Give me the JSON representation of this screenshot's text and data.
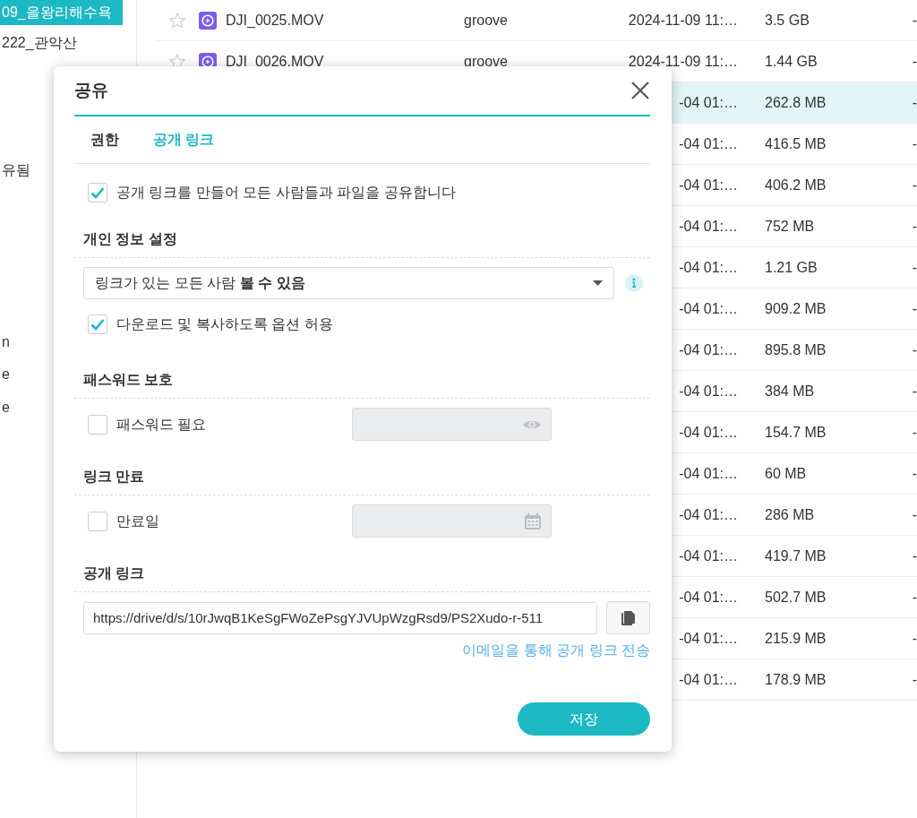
{
  "sidebar": {
    "items": [
      {
        "label": "09_을왕리해수욕",
        "selected": true
      },
      {
        "label": "222_관악산",
        "selected": false
      },
      {
        "label": "유됨",
        "selected": false
      },
      {
        "label": "n",
        "selected": false
      },
      {
        "label": "e",
        "selected": false
      },
      {
        "label": "e",
        "selected": false
      }
    ]
  },
  "file_list": {
    "rows": [
      {
        "starred": false,
        "name": "DJI_0025.MOV",
        "owner": "groove",
        "modified": "2024-11-09 11:…",
        "size": "3.5 GB",
        "column_5": "-",
        "selected": false
      },
      {
        "starred": false,
        "name": "DJI_0026.MOV",
        "owner": "groove",
        "modified": "2024-11-09 11:…",
        "size": "1.44 GB",
        "column_5": "-",
        "selected": false
      },
      {
        "modified": "-04 01:…",
        "size": "262.8 MB",
        "column_5": "-",
        "selected": true
      },
      {
        "modified": "-04 01:…",
        "size": "416.5 MB",
        "column_5": "-",
        "selected": false
      },
      {
        "modified": "-04 01:…",
        "size": "406.2 MB",
        "column_5": "-",
        "selected": false
      },
      {
        "modified": "-04 01:…",
        "size": "752 MB",
        "column_5": "-",
        "selected": false
      },
      {
        "modified": "-04 01:…",
        "size": "1.21 GB",
        "column_5": "-",
        "selected": false
      },
      {
        "modified": "-04 01:…",
        "size": "909.2 MB",
        "column_5": "-",
        "selected": false
      },
      {
        "modified": "-04 01:…",
        "size": "895.8 MB",
        "column_5": "-",
        "selected": false
      },
      {
        "modified": "-04 01:…",
        "size": "384 MB",
        "column_5": "-",
        "selected": false
      },
      {
        "modified": "-04 01:…",
        "size": "154.7 MB",
        "column_5": "-",
        "selected": false
      },
      {
        "modified": "-04 01:…",
        "size": "60 MB",
        "column_5": "-",
        "selected": false
      },
      {
        "modified": "-04 01:…",
        "size": "286 MB",
        "column_5": "-",
        "selected": false
      },
      {
        "modified": "-04 01:…",
        "size": "419.7 MB",
        "column_5": "-",
        "selected": false
      },
      {
        "modified": "-04 01:…",
        "size": "502.7 MB",
        "column_5": "-",
        "selected": false
      },
      {
        "modified": "-04 01:…",
        "size": "215.9 MB",
        "column_5": "-",
        "selected": false
      },
      {
        "modified": "-04 01:…",
        "size": "178.9 MB",
        "column_5": "-",
        "selected": false
      }
    ]
  },
  "share_dialog": {
    "title": "공유",
    "tabs": [
      {
        "label": "권한",
        "selected": false
      },
      {
        "label": "공개 링크",
        "selected": true
      }
    ],
    "enable_public_link": {
      "label": "공개 링크를 만들어 모든 사람들과 파일을 공유합니다",
      "checked": true
    },
    "privacy": {
      "heading": "개인 정보 설정",
      "access_select": {
        "value": "링크가 있는 모든 사람 **볼 수 있음**"
      },
      "allow_download": {
        "label": "다운로드 및 복사하도록 옵션 허용",
        "checked": true
      }
    },
    "password": {
      "heading": "패스워드 보호",
      "require_password": {
        "label": "패스워드 필요",
        "checked": false
      },
      "password_field": {
        "disabled": true
      }
    },
    "expiry": {
      "heading": "링크 만료",
      "expiry_date": {
        "label": "만료일",
        "checked": false
      },
      "date_field": {
        "disabled": true
      }
    },
    "public_link": {
      "heading": "공개 링크",
      "url": "https://drive/d/s/10rJwqB1KeSgFWoZePsgYJVUpWzgRsd9/PS2Xudo-r-511",
      "email_link": "이메일을 통해 공개 링크 전송"
    },
    "save_button": "저장"
  }
}
